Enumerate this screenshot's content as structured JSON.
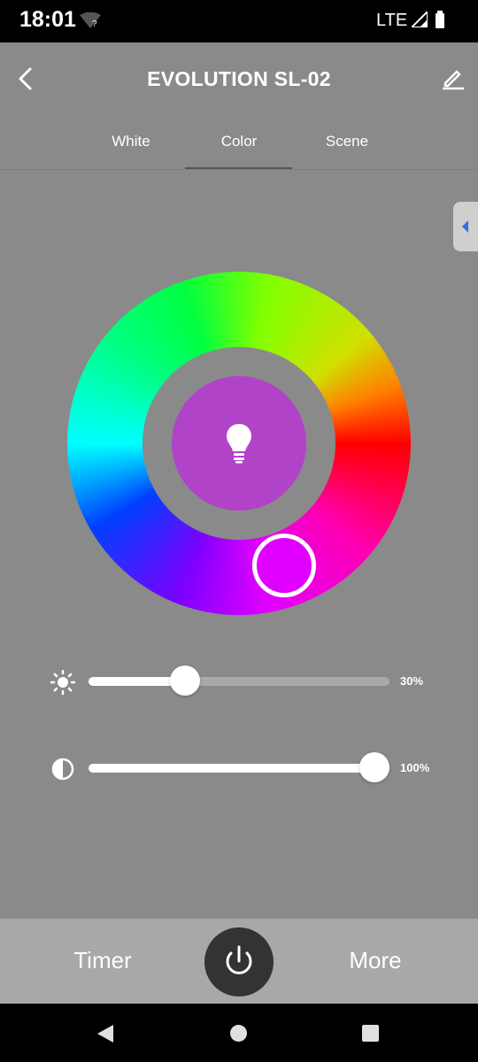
{
  "status_bar": {
    "time": "18:01",
    "network": "LTE",
    "icons": [
      "wifi-question-icon",
      "signal-icon",
      "battery-icon"
    ]
  },
  "header": {
    "title": "EVOLUTION SL-02",
    "back_icon": "chevron-left-icon",
    "edit_icon": "pencil-icon"
  },
  "tabs": [
    {
      "label": "White",
      "selected": false
    },
    {
      "label": "Color",
      "selected": true
    },
    {
      "label": "Scene",
      "selected": false
    }
  ],
  "color_wheel": {
    "selected_color": "#e000ff",
    "center_preview_color": "#b043c8",
    "center_icon": "lightbulb-icon"
  },
  "sliders": {
    "brightness": {
      "icon": "sun-icon",
      "value": 30,
      "label": "30%"
    },
    "saturation": {
      "icon": "contrast-icon",
      "value": 100,
      "label": "100%"
    }
  },
  "bottom_bar": {
    "timer_label": "Timer",
    "more_label": "More",
    "power_icon": "power-icon"
  },
  "colors": {
    "background": "#8a8a8a",
    "bottom_bar": "#a8a8a8",
    "power_button": "#333333",
    "accent_handle": "#3b6be0"
  }
}
